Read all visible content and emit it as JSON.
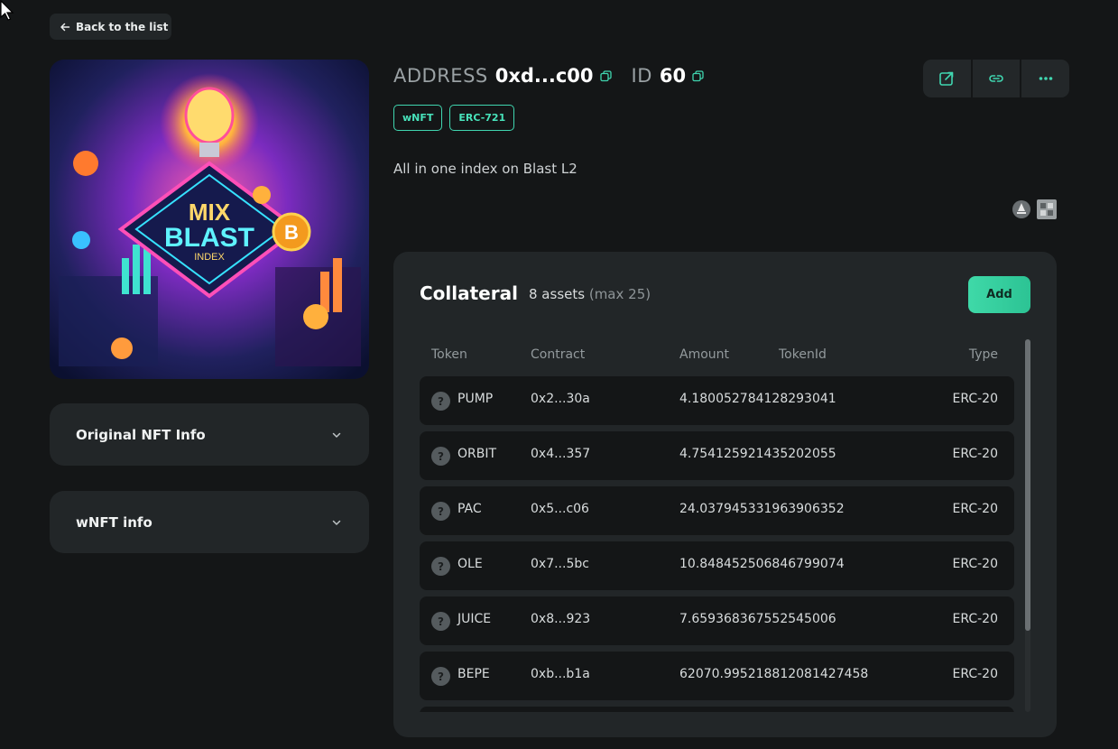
{
  "nav": {
    "back_label": "Back to the list"
  },
  "header": {
    "address_label": "ADDRESS",
    "address_value": "0xd...c00",
    "id_label": "ID",
    "id_value": "60"
  },
  "tags": [
    "wNFT",
    "ERC-721"
  ],
  "description": "All in one index on Blast L2",
  "actions": [
    "external-link-icon",
    "link-icon",
    "more-icon"
  ],
  "accordions": [
    {
      "label": "Original NFT Info"
    },
    {
      "label": "wNFT info"
    }
  ],
  "collateral": {
    "title": "Collateral",
    "count_text": "8 assets",
    "max_text": "(max 25)",
    "add_label": "Add",
    "columns": {
      "token": "Token",
      "contract": "Contract",
      "amount": "Amount",
      "tokenid": "TokenId",
      "type": "Type"
    },
    "rows": [
      {
        "token": "PUMP",
        "contract": "0x2...30a",
        "amount": "4.180052784128293041",
        "type": "ERC-20"
      },
      {
        "token": "ORBIT",
        "contract": "0x4...357",
        "amount": "4.754125921435202055",
        "type": "ERC-20"
      },
      {
        "token": "PAC",
        "contract": "0x5...c06",
        "amount": "24.037945331963906352",
        "type": "ERC-20"
      },
      {
        "token": "OLE",
        "contract": "0x7...5bc",
        "amount": "10.848452506846799074",
        "type": "ERC-20"
      },
      {
        "token": "JUICE",
        "contract": "0x8...923",
        "amount": "7.659368367552545006",
        "type": "ERC-20"
      },
      {
        "token": "BEPE",
        "contract": "0xb...b1a",
        "amount": "62070.995218812081427458",
        "type": "ERC-20"
      }
    ]
  },
  "colors": {
    "background": "#141617",
    "panel": "#222628",
    "accent": "#40d6b0"
  }
}
